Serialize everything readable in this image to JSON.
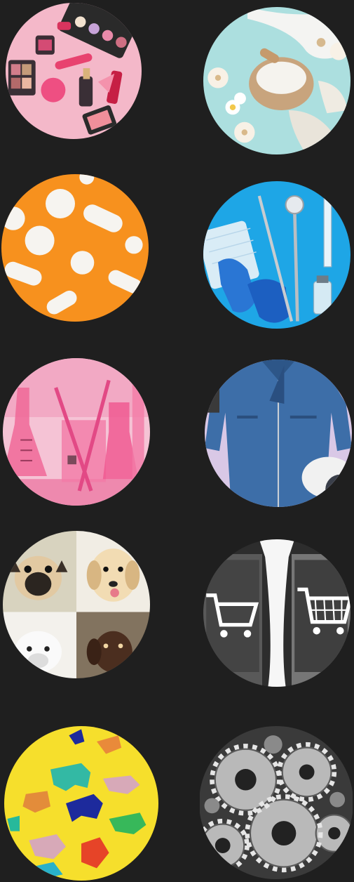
{
  "categories": [
    {
      "id": "cosmetics",
      "icon": "makeup-palette-image",
      "bg": "#f6b3c6"
    },
    {
      "id": "spa",
      "icon": "mortar-salt-candles-image",
      "bg": "#a9dedd"
    },
    {
      "id": "pharma",
      "icon": "white-pills-image",
      "bg": "#f8901c"
    },
    {
      "id": "medical",
      "icon": "gloves-syringe-image",
      "bg": "#1fa4e3"
    },
    {
      "id": "laboratory",
      "icon": "pink-glassware-image",
      "bg": "#ec4f8a"
    },
    {
      "id": "workwear",
      "icon": "denim-overalls-image",
      "bg": "#3d6da6"
    },
    {
      "id": "pets",
      "icon": "puppies-collage-image",
      "bg": "#e8e2d3"
    },
    {
      "id": "retail",
      "icon": "shopping-cart-image",
      "bg": "#4a4a4a"
    },
    {
      "id": "toys",
      "icon": "metallic-animal-figures-image",
      "bg": "#f6e02b"
    },
    {
      "id": "industrial",
      "icon": "metal-gears-image",
      "bg": "#8d8d8d"
    }
  ]
}
